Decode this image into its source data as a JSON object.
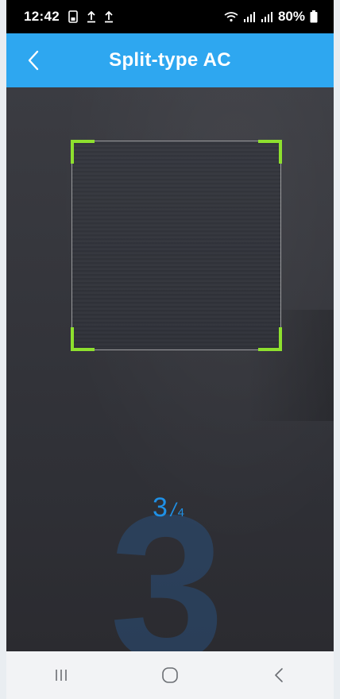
{
  "status_bar": {
    "time": "12:42",
    "battery": "80%",
    "icons": [
      "phone-storage-icon",
      "upload-icon",
      "upload-icon",
      "wifi-icon",
      "signal-icon",
      "signal-icon",
      "battery-icon"
    ]
  },
  "header": {
    "title": "Split-type AC",
    "background": "#2ea7f0"
  },
  "scanner": {
    "frame_corner_color": "#8ee02e",
    "big_step": "3",
    "step_current": "3",
    "step_separator": "/",
    "step_total": "4",
    "counter_color": "#1f90e6"
  },
  "nav_bar": {
    "buttons": [
      "recent-apps-icon",
      "home-icon",
      "back-icon"
    ]
  }
}
